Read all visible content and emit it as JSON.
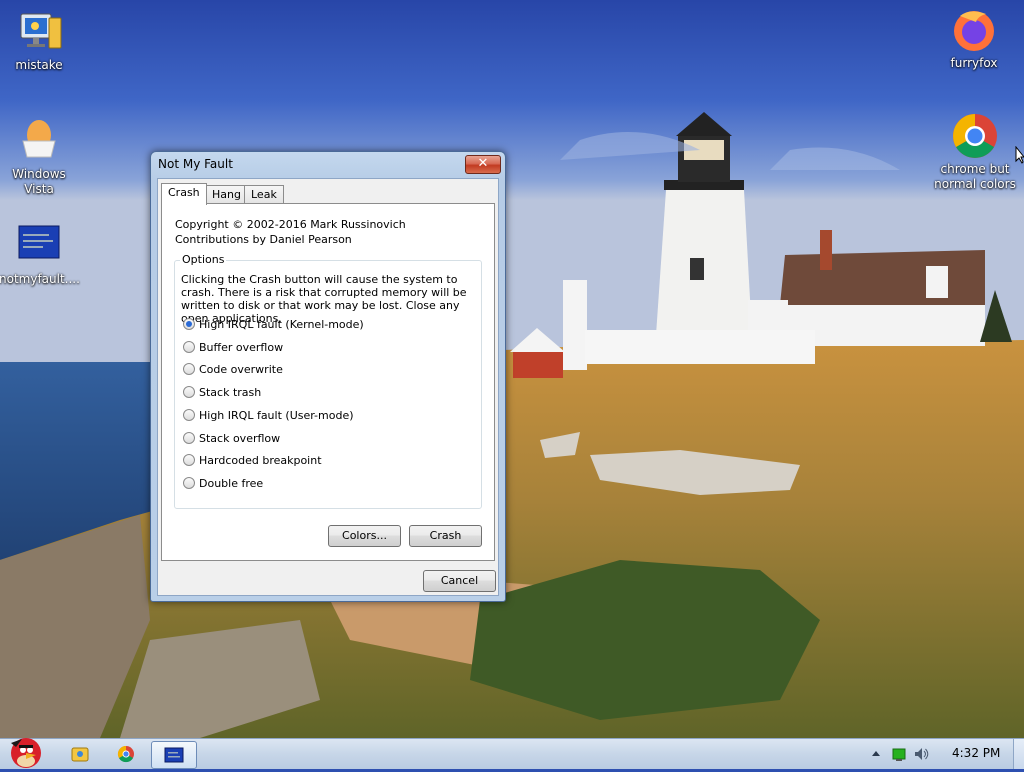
{
  "desktop": {
    "icons": [
      {
        "label": "mistake",
        "icon": "monitor-tower-icon"
      },
      {
        "label": "Windows Vista",
        "icon": "egg-icon"
      },
      {
        "label": "notmyfault....",
        "icon": "bluescreen-icon"
      },
      {
        "label": "furryfox",
        "icon": "firefox-icon"
      },
      {
        "label": "chrome but normal colors",
        "icon": "chrome-icon"
      }
    ]
  },
  "dialog": {
    "title": "Not My Fault",
    "close_label": "✕",
    "tabs": [
      "Crash",
      "Hang",
      "Leak"
    ],
    "active_tab": "Crash",
    "copyright": "Copyright © 2002-2016 Mark Russinovich",
    "contributions": "Contributions by Daniel Pearson",
    "options_label": "Options",
    "warning": "Clicking the Crash button will cause the system to crash. There is a risk that corrupted memory will be written to disk or that work may be lost. Close any open applications.",
    "options": [
      "High IRQL fault (Kernel-mode)",
      "Buffer overflow",
      "Code overwrite",
      "Stack trash",
      "High IRQL fault (User-mode)",
      "Stack overflow",
      "Hardcoded breakpoint",
      "Double free"
    ],
    "selected_option": "High IRQL fault (Kernel-mode)",
    "colors_button": "Colors...",
    "crash_button": "Crash",
    "cancel_button": "Cancel"
  },
  "taskbar": {
    "start_icon": "angry-bird-icon",
    "pinned": [
      "explorer-icon",
      "chrome-icon",
      "notmyfault-icon"
    ],
    "active_item": "notmyfault-icon",
    "tray": [
      "show-hidden-arrow-icon",
      "network-icon",
      "volume-icon"
    ],
    "clock": "4:32 PM"
  },
  "colors": {
    "sky": "#3f67c8",
    "taskbar": "#c7d6e8",
    "dialog_frame": "#b9cfe8",
    "close_button": "#c23b22",
    "radio_selected": "#2a6ad6"
  }
}
